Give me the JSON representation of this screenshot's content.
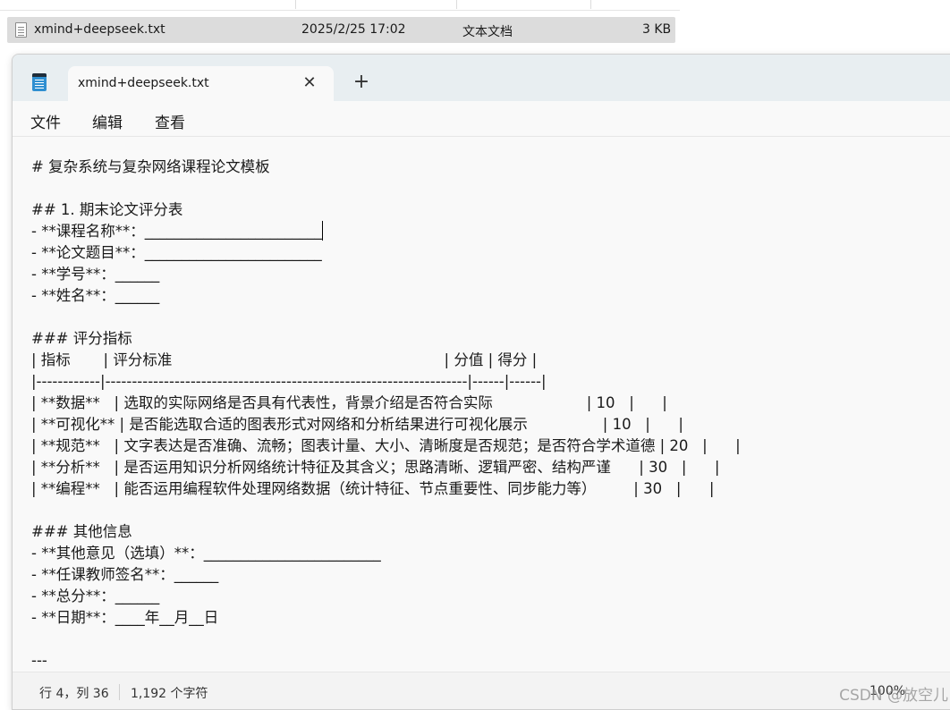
{
  "file": {
    "name": "xmind+deepseek.txt",
    "modified": "2025/2/25 17:02",
    "type": "文本文档",
    "size": "3 KB"
  },
  "window": {
    "tab_title": "xmind+deepseek.txt",
    "close_symbol": "✕",
    "new_tab_symbol": "+"
  },
  "menu": [
    "文件",
    "编辑",
    "查看"
  ],
  "content_lines": [
    "# 复杂系统与复杂网络课程论文模板",
    "",
    "## 1. 期末论文评分表",
    "- **课程名称**：________________________",
    "- **论文题目**：________________________",
    "- **学号**：______",
    "- **姓名**：______",
    "",
    "### 评分指标",
    "| 指标       | 评分标准                                                          | 分值 | 得分 |",
    "|------------|--------------------------------------------------------------------|------|------|",
    "| **数据**   | 选取的实际网络是否具有代表性，背景介绍是否符合实际                    | 10   |      |",
    "| **可视化** | 是否能选取合适的图表形式对网络和分析结果进行可视化展示                | 10   |      |",
    "| **规范**   | 文字表达是否准确、流畅；图表计量、大小、清晰度是否规范；是否符合学术道德 | 20   |      |",
    "| **分析**   | 是否运用知识分析网络统计特征及其含义；思路清晰、逻辑严密、结构严谨      | 30   |      |",
    "| **编程**   | 能否运用编程软件处理网络数据（统计特征、节点重要性、同步能力等）        | 30   |      |",
    "",
    "### 其他信息",
    "- **其他意见（选填）**：________________________",
    "- **任课教师签名**：______",
    "- **总分**：______",
    "- **日期**：____年__月__日",
    "",
    "---"
  ],
  "status": {
    "position": "行 4，列 36",
    "char_count": "1,192 个字符",
    "zoom": "100%"
  },
  "watermark": "CSDN @放空儿"
}
